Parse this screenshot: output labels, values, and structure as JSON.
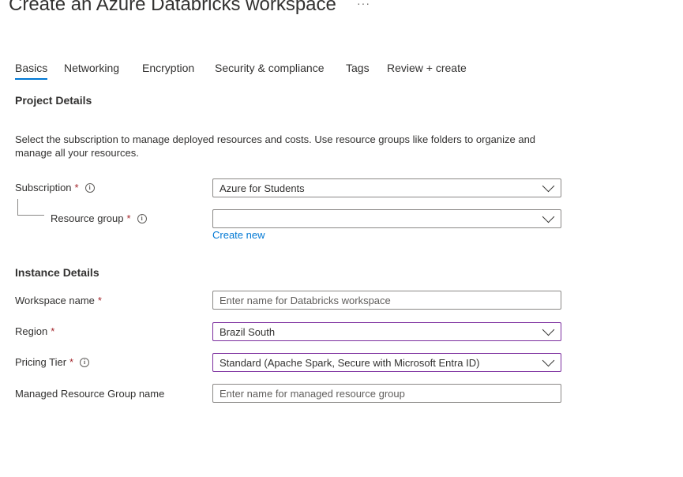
{
  "page": {
    "title": "Create an Azure Databricks workspace",
    "more": "···"
  },
  "tabs": [
    {
      "label": "Basics",
      "active": true
    },
    {
      "label": "Networking"
    },
    {
      "label": "Encryption"
    },
    {
      "label": "Security & compliance"
    },
    {
      "label": "Tags"
    },
    {
      "label": "Review + create"
    }
  ],
  "project": {
    "heading": "Project Details",
    "description": "Select the subscription to manage deployed resources and costs. Use resource groups like folders to organize and manage all your resources.",
    "subscription": {
      "label": "Subscription",
      "required": "*",
      "value": "Azure for Students"
    },
    "resource_group": {
      "label": "Resource group",
      "required": "*",
      "value": "",
      "create_new": "Create new"
    }
  },
  "instance": {
    "heading": "Instance Details",
    "workspace_name": {
      "label": "Workspace name",
      "required": "*",
      "placeholder": "Enter name for Databricks workspace"
    },
    "region": {
      "label": "Region",
      "required": "*",
      "value": "Brazil South"
    },
    "pricing_tier": {
      "label": "Pricing Tier",
      "required": "*",
      "value": "Standard (Apache Spark, Secure with Microsoft Entra ID)"
    },
    "managed_rg": {
      "label": "Managed Resource Group name",
      "placeholder": "Enter name for managed resource group"
    }
  },
  "icons": {
    "info": "i"
  },
  "colors": {
    "accent": "#0078d4",
    "required": "#a4262c",
    "focus_border": "#7b2d9e"
  }
}
